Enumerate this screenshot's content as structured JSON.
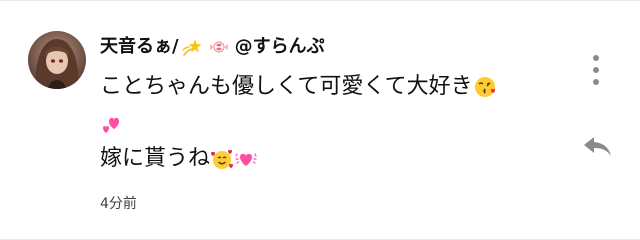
{
  "comment": {
    "author_name": "天音るぁ/",
    "author_handle": "@すらんぷ",
    "text_line1": "ことちゃんも優しくて可愛くて大好き",
    "text_line2": "",
    "text_line3": "嫁に貰うね",
    "time": "4分前",
    "icons": {
      "author_emoji_1": "dizzy-star-icon",
      "author_emoji_2": "candy-icon",
      "line1_emoji": "kissing-face-icon",
      "line2_emoji": "two-hearts-icon",
      "line3_emoji_1": "smiling-face-with-hearts-icon",
      "line3_emoji_2": "beating-heart-icon",
      "more": "more-vertical-icon",
      "reply": "reply-arrow-icon"
    },
    "colors": {
      "heart_pink": "#ff4fa3",
      "icon_grey": "#8a8a8a"
    }
  }
}
